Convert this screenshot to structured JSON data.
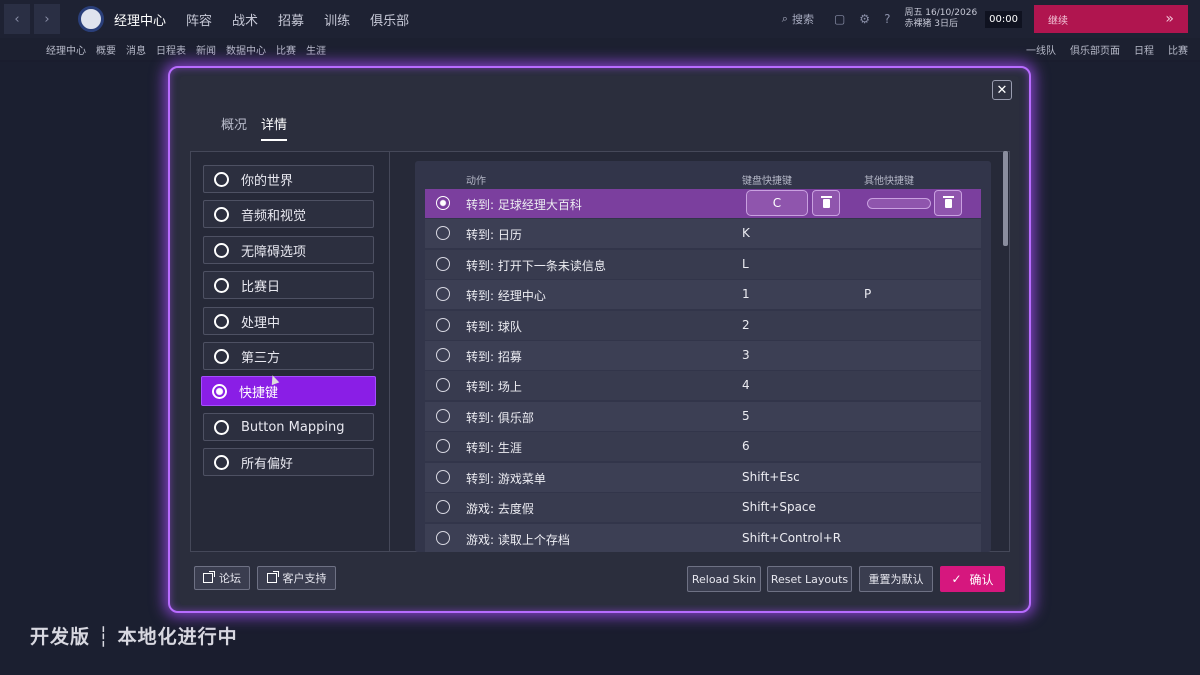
{
  "topbar": {
    "menu": [
      "经理中心",
      "阵容",
      "战术",
      "招募",
      "训练",
      "俱乐部"
    ],
    "search_label": "搜索",
    "date_line1": "周五 16/10/2026",
    "date_line2": "赤裸猪 3日后",
    "time": "00:00",
    "continue_label": "继续"
  },
  "subbar": {
    "items": [
      "经理中心",
      "概要",
      "消息",
      "日程表",
      "新闻",
      "数据中心",
      "比赛",
      "生涯"
    ],
    "right_items": [
      "一线队",
      "俱乐部页面",
      "日程",
      "比赛"
    ]
  },
  "modal": {
    "tabs": [
      "概况",
      "详情"
    ],
    "active_tab": 1,
    "categories": [
      "你的世界",
      "音频和视觉",
      "无障碍选项",
      "比赛日",
      "处理中",
      "第三方",
      "快捷键",
      "Button Mapping",
      "所有偏好"
    ],
    "active_category": 6,
    "table": {
      "headers": {
        "action": "动作",
        "keyboard": "键盘快捷键",
        "other": "其他快捷键"
      },
      "rows": [
        {
          "action": "转到: 足球经理大百科",
          "key": "C",
          "other": ""
        },
        {
          "action": "转到: 日历",
          "key": "K",
          "other": ""
        },
        {
          "action": "转到: 打开下一条未读信息",
          "key": "L",
          "other": ""
        },
        {
          "action": "转到: 经理中心",
          "key": "1",
          "other": "P"
        },
        {
          "action": "转到: 球队",
          "key": "2",
          "other": ""
        },
        {
          "action": "转到: 招募",
          "key": "3",
          "other": ""
        },
        {
          "action": "转到: 场上",
          "key": "4",
          "other": ""
        },
        {
          "action": "转到: 俱乐部",
          "key": "5",
          "other": ""
        },
        {
          "action": "转到: 生涯",
          "key": "6",
          "other": ""
        },
        {
          "action": "转到: 游戏菜单",
          "key": "Shift+Esc",
          "other": ""
        },
        {
          "action": "游戏: 去度假",
          "key": "Shift+Space",
          "other": ""
        },
        {
          "action": "游戏: 读取上个存档",
          "key": "Shift+Control+R",
          "other": ""
        }
      ]
    },
    "footer": {
      "forum": "论坛",
      "support": "客户支持",
      "reload_skin": "Reload Skin",
      "reset_layouts": "Reset Layouts",
      "reset_default": "重置为默认",
      "confirm": "确认"
    }
  },
  "watermark": "开发版 ┆ 本地化进行中",
  "colors": {
    "accent": "#8a1ee6",
    "selected_row": "#7b3f9e",
    "confirm": "#d6177e",
    "glow": "#b86cff"
  }
}
